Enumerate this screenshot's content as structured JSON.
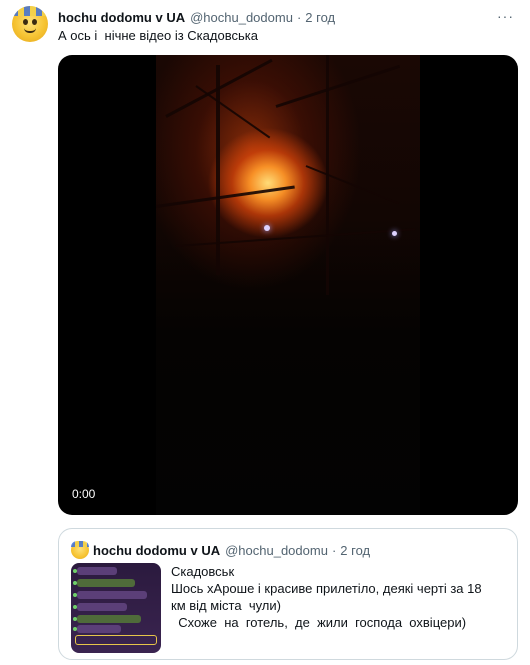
{
  "tweet": {
    "author_name": "hochu dodomu v UA",
    "handle": "@hochu_dodomu",
    "separator": "·",
    "time": "2 год",
    "more_label": "···",
    "text": "А ось і  нічне відео із Скадовська",
    "video": {
      "timecode": "0:00"
    }
  },
  "quote": {
    "author_name": "hochu dodomu v UA",
    "handle": "@hochu_dodomu",
    "separator": "·",
    "time": "2 год",
    "lines": [
      "Скадовськ",
      "Шось хАроше і красиве прилетіло, деякі черті за 18",
      "км від міста  чули)",
      "  Схоже  на  готель,  де  жили  господа  охвіцери)"
    ]
  },
  "colors": {
    "text": "#0f1419",
    "secondary": "#536471",
    "border": "#cfd9de",
    "video_bg": "#000000"
  }
}
